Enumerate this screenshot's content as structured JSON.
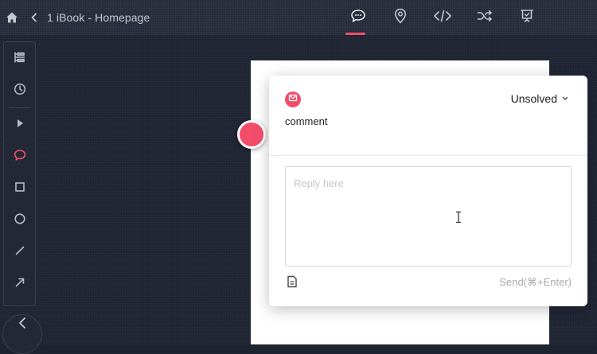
{
  "header": {
    "title": "1 iBook - Homepage",
    "home_icon": "home-icon",
    "back_icon": "chevron-left-icon",
    "tabs": [
      {
        "name": "comments",
        "icon": "comment-icon",
        "active": true
      },
      {
        "name": "location",
        "icon": "map-pin-icon",
        "active": false
      },
      {
        "name": "code",
        "icon": "code-icon",
        "active": false
      },
      {
        "name": "shuffle",
        "icon": "shuffle-icon",
        "active": false
      },
      {
        "name": "presentation",
        "icon": "presentation-icon",
        "active": false
      }
    ]
  },
  "toolbar": {
    "tools": [
      "layers-icon",
      "history-icon",
      "pointer-icon",
      "comment-icon",
      "rectangle-icon",
      "ellipse-icon",
      "line-icon",
      "arrow-icon"
    ],
    "active_tool": "comment-icon",
    "collapse_icon": "chevron-left-icon"
  },
  "comment_popup": {
    "status": "Unsolved",
    "comment": "comment",
    "reply_placeholder": "Reply here",
    "reply_value": "",
    "send_label": "Send(⌘+Enter)"
  },
  "colors": {
    "accent": "#f24e6c",
    "background": "#1f2433",
    "topbar": "#262c3a"
  }
}
